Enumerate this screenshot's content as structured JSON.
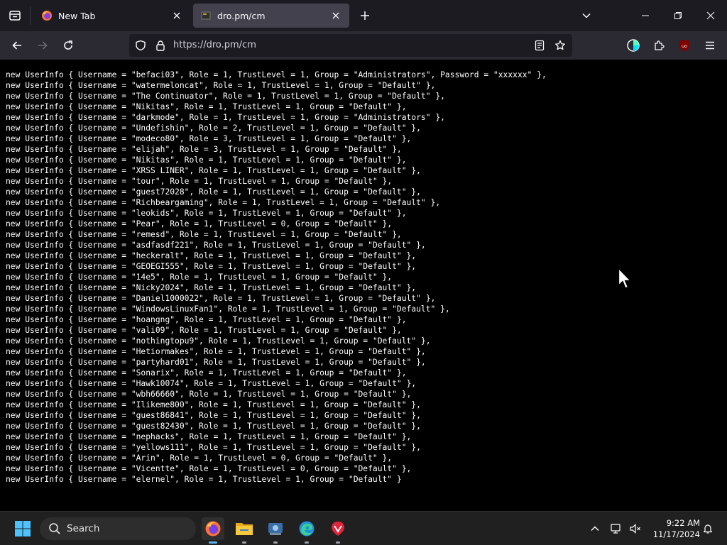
{
  "browser": {
    "tabs": [
      {
        "title": "New Tab",
        "favicon": "firefox-icon",
        "active": false
      },
      {
        "title": "dro.pm/cm",
        "favicon": "page-favicon",
        "active": true
      }
    ],
    "url": "https://dro.pm/cm"
  },
  "page": {
    "lines": [
      "new UserInfo { Username = \"befaci03\", Role = 1, TrustLevel = 1, Group = \"Administrators\", Password = \"xxxxxx\" },",
      "new UserInfo { Username = \"watermeloncat\", Role = 1, TrustLevel = 1, Group = \"Default\" },",
      "new UserInfo { Username = \"The Continuator\", Role = 1, TrustLevel = 1, Group = \"Default\" },",
      "new UserInfo { Username = \"Nikitas\", Role = 1, TrustLevel = 1, Group = \"Default\" },",
      "new UserInfo { Username = \"darkmode\", Role = 1, TrustLevel = 1, Group = \"Administrators\" },",
      "new UserInfo { Username = \"Undefishin\", Role = 2, TrustLevel = 1, Group = \"Default\" },",
      "new UserInfo { Username = \"modeco80\", Role = 3, TrustLevel = 1, Group = \"Default\" },",
      "new UserInfo { Username = \"elijah\", Role = 3, TrustLevel = 1, Group = \"Default\" },",
      "new UserInfo { Username = \"Nikitas\", Role = 1, TrustLevel = 1, Group = \"Default\" },",
      "new UserInfo { Username = \"XRSS LINER\", Role = 1, TrustLevel = 1, Group = \"Default\" },",
      "new UserInfo { Username = \"tour\", Role = 1, TrustLevel = 1, Group = \"Default\" },",
      "new UserInfo { Username = \"guest72028\", Role = 1, TrustLevel = 1, Group = \"Default\" },",
      "new UserInfo { Username = \"Richbeargaming\", Role = 1, TrustLevel = 1, Group = \"Default\" },",
      "new UserInfo { Username = \"leokids\", Role = 1, TrustLevel = 1, Group = \"Default\" },",
      "new UserInfo { Username = \"Pear\", Role = 1, TrustLevel = 0, Group = \"Default\" },",
      "new UserInfo { Username = \"remesd\", Role = 1, TrustLevel = 1, Group = \"Default\" },",
      "new UserInfo { Username = \"asdfasdf221\", Role = 1, TrustLevel = 1, Group = \"Default\" },",
      "new UserInfo { Username = \"heckeralt\", Role = 1, TrustLevel = 1, Group = \"Default\" },",
      "new UserInfo { Username = \"GEOEGI555\", Role = 1, TrustLevel = 1, Group = \"Default\" },",
      "new UserInfo { Username = \"14e5\", Role = 1, TrustLevel = 1, Group = \"Default\" },",
      "new UserInfo { Username = \"Nicky2024\", Role = 1, TrustLevel = 1, Group = \"Default\" },",
      "new UserInfo { Username = \"Daniel1000022\", Role = 1, TrustLevel = 1, Group = \"Default\" },",
      "new UserInfo { Username = \"WindowsLinuxFan1\", Role = 1, TrustLevel = 1, Group = \"Default\" },",
      "new UserInfo { Username = \"hoangng\", Role = 1, TrustLevel = 1, Group = \"Default\" },",
      "new UserInfo { Username = \"vali09\", Role = 1, TrustLevel = 1, Group = \"Default\" },",
      "new UserInfo { Username = \"nothingtopu9\", Role = 1, TrustLevel = 1, Group = \"Default\" },",
      "new UserInfo { Username = \"Hetiormakes\", Role = 1, TrustLevel = 1, Group = \"Default\" },",
      "new UserInfo { Username = \"partyhard01\", Role = 1, TrustLevel = 1, Group = \"Default\" },",
      "new UserInfo { Username = \"Sonarix\", Role = 1, TrustLevel = 1, Group = \"Default\" },",
      "new UserInfo { Username = \"Hawk10074\", Role = 1, TrustLevel = 1, Group = \"Default\" },",
      "new UserInfo { Username = \"wbh66660\", Role = 1, TrustLevel = 1, Group = \"Default\" },",
      "new UserInfo { Username = \"Ilikeme800\", Role = 1, TrustLevel = 1, Group = \"Default\" },",
      "new UserInfo { Username = \"guest86841\", Role = 1, TrustLevel = 1, Group = \"Default\" },",
      "new UserInfo { Username = \"guest82430\", Role = 1, TrustLevel = 1, Group = \"Default\" },",
      "new UserInfo { Username = \"nephacks\", Role = 1, TrustLevel = 1, Group = \"Default\" },",
      "new UserInfo { Username = \"yellows111\", Role = 1, TrustLevel = 1, Group = \"Default\" },",
      "new UserInfo { Username = \"Arin\", Role = 1, TrustLevel = 0, Group = \"Default\" },",
      "new UserInfo { Username = \"Vicentte\", Role = 1, TrustLevel = 0, Group = \"Default\" },",
      "new UserInfo { Username = \"elernel\", Role = 1, TrustLevel = 1, Group = \"Default\" }"
    ]
  },
  "taskbar": {
    "search_label": "Search",
    "apps": [
      "firefox-icon",
      "file-explorer-icon",
      "app-icon",
      "edge-icon",
      "vivaldi-icon"
    ],
    "time": "9:22 AM",
    "date": "11/17/2024"
  },
  "colors": {
    "tabstrip": "#1c1b22",
    "toolbar": "#2b2a33",
    "content_bg": "#000000",
    "taskbar": "#202020"
  }
}
